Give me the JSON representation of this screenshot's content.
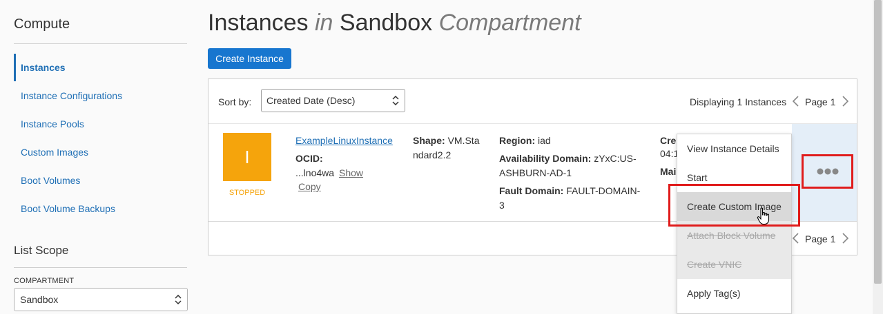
{
  "sidebar": {
    "title": "Compute",
    "items": [
      {
        "label": "Instances",
        "active": true
      },
      {
        "label": "Instance Configurations"
      },
      {
        "label": "Instance Pools"
      },
      {
        "label": "Custom Images"
      },
      {
        "label": "Boot Volumes"
      },
      {
        "label": "Boot Volume Backups"
      }
    ],
    "scope_title": "List Scope",
    "compartment_label": "COMPARTMENT",
    "compartment_value": "Sandbox"
  },
  "header": {
    "title_part1": "Instances",
    "title_in": "in",
    "title_part2": "Sandbox",
    "title_part3": "Compartment",
    "create_button": "Create Instance"
  },
  "toolbar": {
    "sort_label": "Sort by:",
    "sort_value": "Created Date (Desc)",
    "display_count": "Displaying 1 Instances",
    "page_label": "Page 1"
  },
  "instance": {
    "avatar_letter": "I",
    "state": "STOPPED",
    "name": "ExampleLinuxInstance",
    "ocid_label": "OCID:",
    "ocid_value": "...lno4wa",
    "show_link": "Show",
    "copy_link": "Copy",
    "shape_label": "Shape:",
    "shape_value_1": "VM.Sta",
    "shape_value_2": "ndard2.2",
    "region_label": "Region:",
    "region_value": "iad",
    "ad_label": "Availability Domain:",
    "ad_value_1": "zYxC:US-",
    "ad_value_2": "ASHBURN-AD-1",
    "fd_label": "Fault Domain:",
    "fd_value_1": "FAULT-DOMAIN-",
    "fd_value_2": "3",
    "partial_created": "Cre",
    "partial_time": "04:1",
    "partial_maint": "Mai"
  },
  "menu": {
    "items": [
      {
        "label": "View Instance Details",
        "state": "normal"
      },
      {
        "label": "Start",
        "state": "normal"
      },
      {
        "label": "Create Custom Image",
        "state": "hover"
      },
      {
        "label": "Attach Block Volume",
        "state": "disabled"
      },
      {
        "label": "Create VNIC",
        "state": "disabled"
      },
      {
        "label": "Apply Tag(s)",
        "state": "normal"
      }
    ]
  },
  "footer_pager": {
    "page_label": "Page 1"
  },
  "colors": {
    "accent": "#1776cf",
    "link": "#1f6fb5",
    "stopped": "#f5a40c",
    "highlight": "#e01b1b"
  }
}
